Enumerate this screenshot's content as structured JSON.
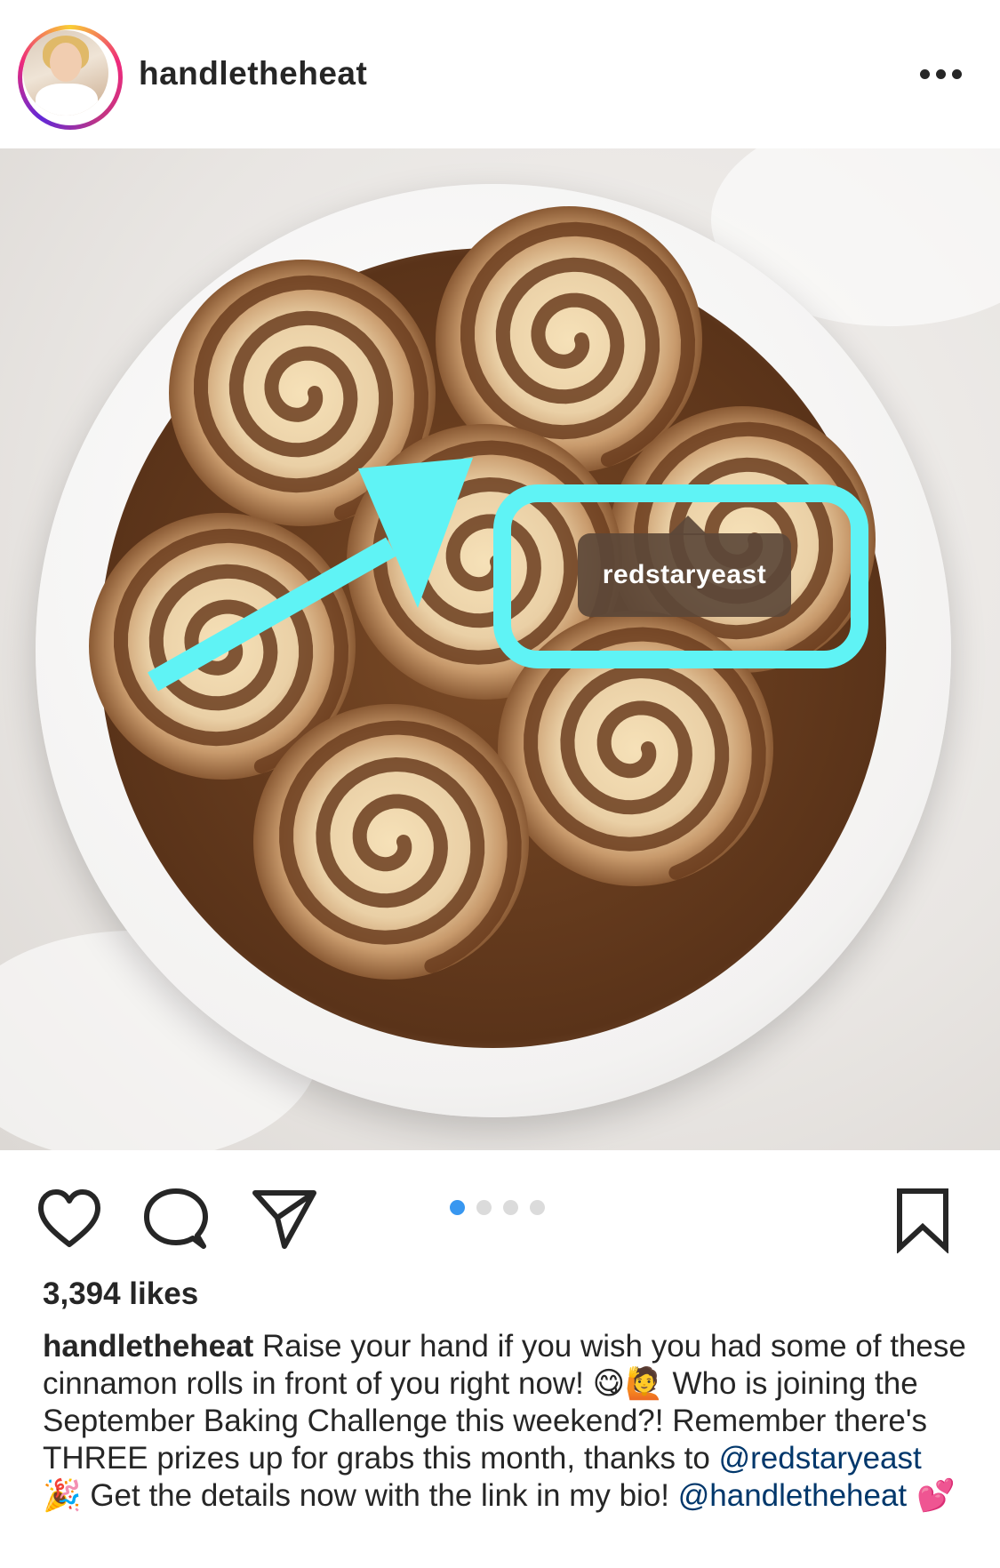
{
  "post": {
    "username": "handletheheat",
    "more_icon": "more-horizontal-icon",
    "tag_label": "redstaryeast",
    "tags_icon": "person-icon"
  },
  "actions": {
    "like_icon": "heart-icon",
    "comment_icon": "comment-icon",
    "share_icon": "send-icon",
    "save_icon": "bookmark-icon",
    "carousel_total": 4,
    "carousel_active": 1
  },
  "stats": {
    "likes": "3,394 likes"
  },
  "caption": {
    "username": "handletheheat",
    "part1": " Raise your hand if you wish you had some of these cinnamon rolls in front of you right now! ",
    "emoji1": "😋🙋",
    "part2": " Who is joining the September Baking Challenge this weekend?! Remember there's THREE prizes up for grabs this month, thanks to ",
    "mention1": "@redstaryeast",
    "emoji2": " 🎉",
    "part3": " Get the details now with the link in my bio! ",
    "mention2": "@handletheheat",
    "emoji3": " 💕"
  },
  "colors": {
    "highlight": "#5ff3f5",
    "carousel_active": "#3897f0",
    "mention": "#00376b"
  }
}
